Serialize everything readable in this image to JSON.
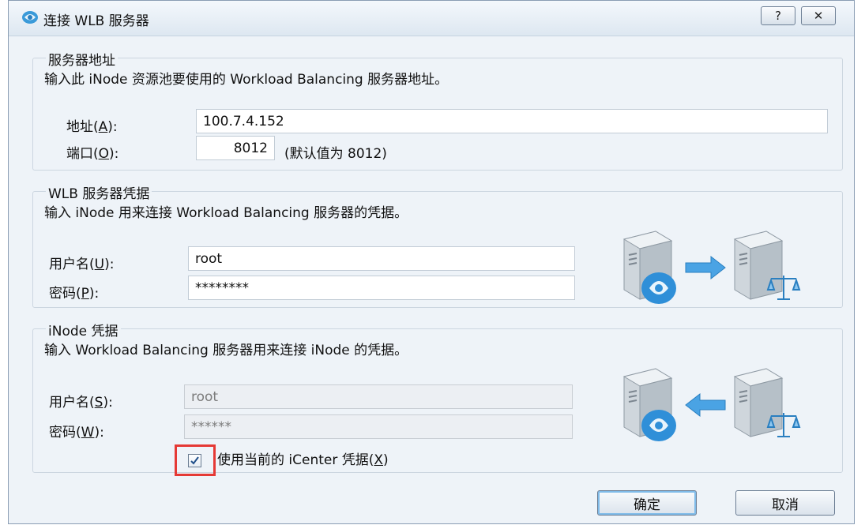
{
  "window": {
    "title": "连接 WLB 服务器",
    "help_label": "?",
    "close_label": "✕"
  },
  "server_address": {
    "legend": "服务器地址",
    "description": "输入此 iNode 资源池要使用的 Workload Balancing 服务器地址。",
    "address_label": "地址(",
    "address_mnemonic": "A",
    "address_label_end": "):",
    "address_value": "100.7.4.152",
    "port_label": "端口(",
    "port_mnemonic": "O",
    "port_label_end": "):",
    "port_value": "8012",
    "port_hint": "(默认值为 8012)"
  },
  "wlb_credentials": {
    "legend": "WLB 服务器凭据",
    "description": "输入 iNode 用来连接 Workload Balancing 服务器的凭据。",
    "username_label": "用户名(",
    "username_mnemonic": "U",
    "username_label_end": "):",
    "username_value": "root",
    "password_label": "密码(",
    "password_mnemonic": "P",
    "password_label_end": "):",
    "password_value": "********"
  },
  "inode_credentials": {
    "legend": "iNode 凭据",
    "description": "输入 Workload Balancing 服务器用来连接 iNode 的凭据。",
    "username_label": "用户名(",
    "username_mnemonic": "S",
    "username_label_end": "):",
    "username_value": "root",
    "password_label": "密码(",
    "password_mnemonic": "W",
    "password_label_end": "):",
    "password_value": "******",
    "use_current_label": "使用当前的 iCenter 凭据(",
    "use_current_mnemonic": "X",
    "use_current_label_end": ")",
    "use_current_checked": true
  },
  "buttons": {
    "ok": "确定",
    "cancel": "取消"
  },
  "colors": {
    "highlight_box": "#e53935",
    "accent": "#2f8fd8"
  }
}
